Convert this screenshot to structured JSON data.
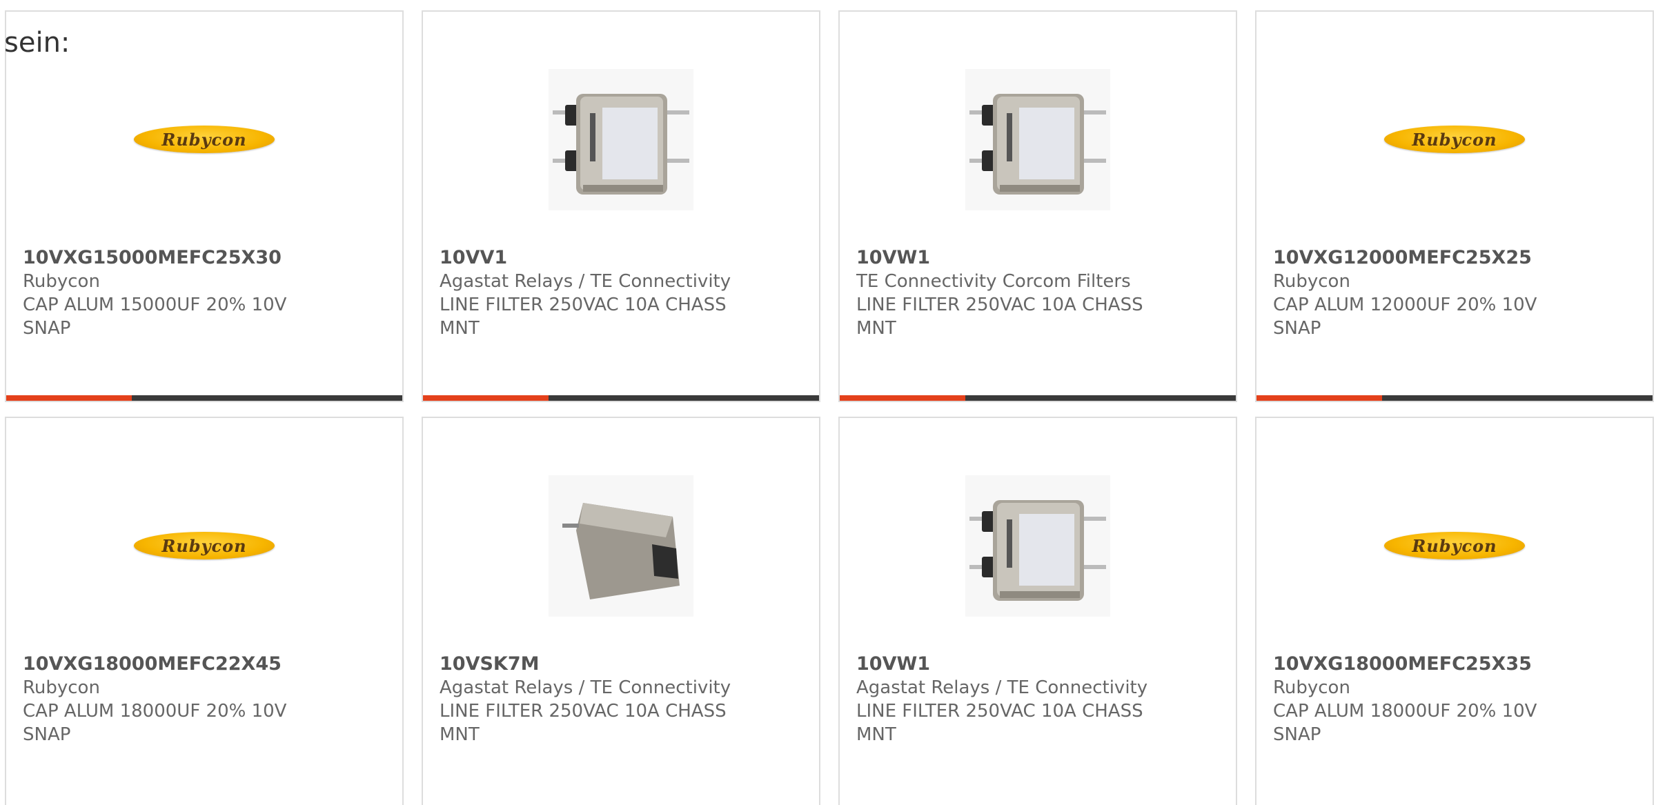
{
  "intro_text": "sein:",
  "colors": {
    "accent": "#e4411b",
    "bar": "#3a3a3a",
    "border": "#dddddd",
    "text": "#666666"
  },
  "cards": [
    {
      "part_number": "10VXG15000MEFC25X30",
      "manufacturer": "Rubycon",
      "description_line1": "CAP ALUM 15000UF 20% 10V",
      "description_line2": "SNAP",
      "image": "rubycon-logo",
      "logo_text": "Rubycon"
    },
    {
      "part_number": "10VV1",
      "manufacturer": "Agastat Relays / TE Connectivity",
      "description_line1": "LINE FILTER 250VAC 10A CHASS",
      "description_line2": "MNT",
      "image": "line-filter-photo"
    },
    {
      "part_number": "10VW1",
      "manufacturer": "TE Connectivity Corcom Filters",
      "description_line1": "LINE FILTER 250VAC 10A CHASS",
      "description_line2": "MNT",
      "image": "line-filter-photo"
    },
    {
      "part_number": "10VXG12000MEFC25X25",
      "manufacturer": "Rubycon",
      "description_line1": "CAP ALUM 12000UF 20% 10V",
      "description_line2": "SNAP",
      "image": "rubycon-logo",
      "logo_text": "Rubycon"
    },
    {
      "part_number": "10VXG18000MEFC22X45",
      "manufacturer": "Rubycon",
      "description_line1": "CAP ALUM 18000UF 20% 10V",
      "description_line2": "SNAP",
      "image": "rubycon-logo",
      "logo_text": "Rubycon"
    },
    {
      "part_number": "10VSK7M",
      "manufacturer": "Agastat Relays / TE Connectivity",
      "description_line1": "LINE FILTER 250VAC 10A CHASS",
      "description_line2": "MNT",
      "image": "iec-filter-photo"
    },
    {
      "part_number": "10VW1",
      "manufacturer": "Agastat Relays / TE Connectivity",
      "description_line1": "LINE FILTER 250VAC 10A CHASS",
      "description_line2": "MNT",
      "image": "line-filter-photo"
    },
    {
      "part_number": "10VXG18000MEFC25X35",
      "manufacturer": "Rubycon",
      "description_line1": "CAP ALUM 18000UF 20% 10V",
      "description_line2": "SNAP",
      "image": "rubycon-logo",
      "logo_text": "Rubycon"
    }
  ]
}
